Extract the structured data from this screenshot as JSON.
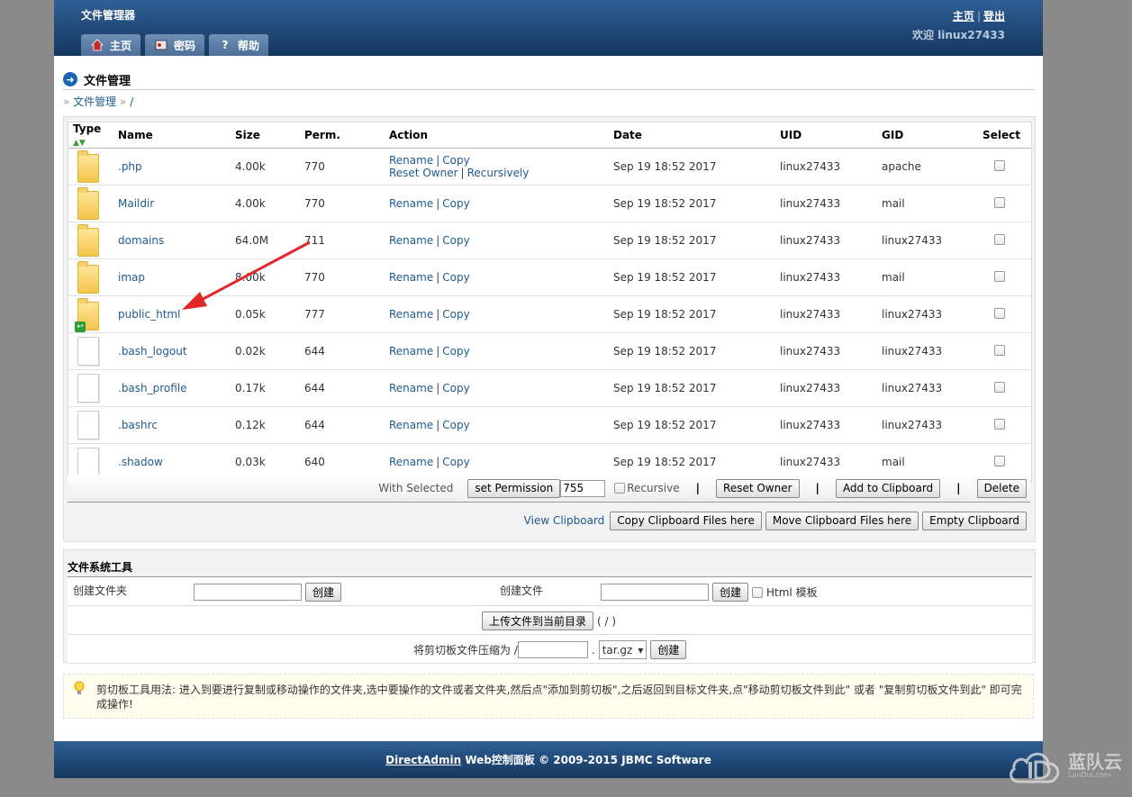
{
  "header": {
    "app_title": "文件管理器",
    "tabs": [
      {
        "label": "主页",
        "icon": "home-icon"
      },
      {
        "label": "密码",
        "icon": "key-icon"
      },
      {
        "label": "帮助",
        "icon": "help-icon"
      }
    ],
    "links": {
      "home": "主页",
      "logout": "登出",
      "separator": "|"
    },
    "welcome": "欢迎 linux27433"
  },
  "page": {
    "title": "文件管理",
    "breadcrumb": {
      "prefix": "»",
      "link": "文件管理",
      "sep": "»",
      "path": "/"
    }
  },
  "table": {
    "columns": [
      "Type",
      "Name",
      "Size",
      "Perm.",
      "Action",
      "Date",
      "UID",
      "GID",
      "Select"
    ],
    "rows": [
      {
        "type": "folder",
        "name": ".php",
        "size": "4.00k",
        "perm": "770",
        "date": "Sep 19 18:52 2017",
        "uid": "linux27433",
        "gid": "apache",
        "extra_actions": true
      },
      {
        "type": "folder",
        "name": "Maildir",
        "size": "4.00k",
        "perm": "770",
        "date": "Sep 19 18:52 2017",
        "uid": "linux27433",
        "gid": "mail"
      },
      {
        "type": "folder",
        "name": "domains",
        "size": "64.0M",
        "perm": "711",
        "date": "Sep 19 18:52 2017",
        "uid": "linux27433",
        "gid": "linux27433"
      },
      {
        "type": "folder",
        "name": "imap",
        "size": "8.00k",
        "perm": "770",
        "date": "Sep 19 18:52 2017",
        "uid": "linux27433",
        "gid": "mail"
      },
      {
        "type": "folder-link",
        "name": "public_html",
        "size": "0.05k",
        "perm": "777",
        "date": "Sep 19 18:52 2017",
        "uid": "linux27433",
        "gid": "linux27433"
      },
      {
        "type": "file",
        "name": ".bash_logout",
        "size": "0.02k",
        "perm": "644",
        "date": "Sep 19 18:52 2017",
        "uid": "linux27433",
        "gid": "linux27433"
      },
      {
        "type": "file",
        "name": ".bash_profile",
        "size": "0.17k",
        "perm": "644",
        "date": "Sep 19 18:52 2017",
        "uid": "linux27433",
        "gid": "linux27433"
      },
      {
        "type": "file",
        "name": ".bashrc",
        "size": "0.12k",
        "perm": "644",
        "date": "Sep 19 18:52 2017",
        "uid": "linux27433",
        "gid": "linux27433"
      },
      {
        "type": "file",
        "name": ".shadow",
        "size": "0.03k",
        "perm": "640",
        "date": "Sep 19 18:52 2017",
        "uid": "linux27433",
        "gid": "mail"
      }
    ],
    "action_labels": {
      "rename": "Rename",
      "copy": "Copy",
      "reset_owner": "Reset Owner",
      "recursively": "Recursively",
      "sep": "|"
    }
  },
  "selected_actions": {
    "label": "With Selected",
    "set_permission": "set Permission",
    "perm_value": "755",
    "recursive": "Recursive",
    "reset_owner": "Reset Owner",
    "add_clipboard": "Add to Clipboard",
    "delete": "Delete",
    "pipe": "|"
  },
  "clipboard": {
    "view": "View Clipboard",
    "copy_here": "Copy Clipboard Files here",
    "move_here": "Move Clipboard Files here",
    "empty": "Empty Clipboard"
  },
  "tools": {
    "title": "文件系统工具",
    "create_folder_label": "创建文件夹",
    "create_button": "创建",
    "create_file_label": "创建文件",
    "html_template": "Html 模板",
    "upload_button": "上传文件到当前目录",
    "upload_path": "( / )",
    "compress_label": "将剪切板文件压缩为 /",
    "compress_dot": ".",
    "compress_ext": "tar.gz"
  },
  "tip": {
    "text": "剪切板工具用法: 进入到要进行复制或移动操作的文件夹,选中要操作的文件或者文件夹,然后点\"添加到剪切板\",之后返回到目标文件夹,点\"移动剪切板文件到此\" 或者 \"复制剪切板文件到此\" 即可完成操作!"
  },
  "footer": {
    "link": "DirectAdmin",
    "text": " Web控制面板 © 2009-2015 JBMC Software"
  },
  "watermark": {
    "text": "蓝队云",
    "sub": "LanDui.com"
  },
  "colors": {
    "header": "#1f4a7c",
    "link": "#1f5a8f",
    "arrow": "#e0282b"
  }
}
